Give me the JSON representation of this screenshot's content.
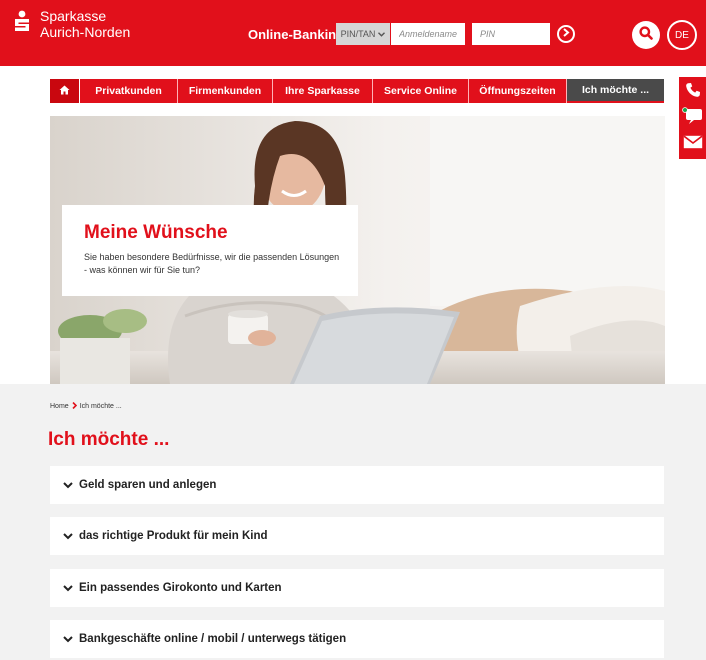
{
  "header": {
    "brand_line1": "Sparkasse",
    "brand_line2": "Aurich-Norden",
    "online_banking_label": "Online-Banking",
    "auth_method": "PIN/TAN",
    "username_placeholder": "Anmeldename",
    "pin_placeholder": "PIN",
    "language": "DE"
  },
  "nav": {
    "items": [
      {
        "label": "Privatkunden"
      },
      {
        "label": "Firmenkunden"
      },
      {
        "label": "Ihre Sparkasse"
      },
      {
        "label": "Service Online"
      },
      {
        "label": "Öffnungszeiten"
      },
      {
        "label": "Ich möchte ..."
      }
    ]
  },
  "hero": {
    "title": "Meine Wünsche",
    "text": "Sie haben besondere Bedürfnisse, wir die passenden Lösungen - was können wir für Sie tun?"
  },
  "breadcrumb": {
    "home": "Home",
    "current": "Ich möchte ..."
  },
  "main": {
    "title": "Ich möchte ...",
    "accordion": [
      {
        "label": "Geld sparen und anlegen"
      },
      {
        "label": "das richtige Produkt für mein Kind"
      },
      {
        "label": "Ein passendes Girokonto und Karten"
      },
      {
        "label": "Bankgeschäfte online / mobil / unterwegs tätigen"
      }
    ]
  },
  "colors": {
    "brand_red": "#e1101b",
    "active_nav": "#4a4a4a",
    "content_bg": "#f2f2f2"
  },
  "icons": [
    "sparkasse-logo-icon",
    "chevron-down-icon",
    "arrow-right-circle-icon",
    "search-icon",
    "phone-icon",
    "chat-icon",
    "mail-icon",
    "home-icon"
  ]
}
